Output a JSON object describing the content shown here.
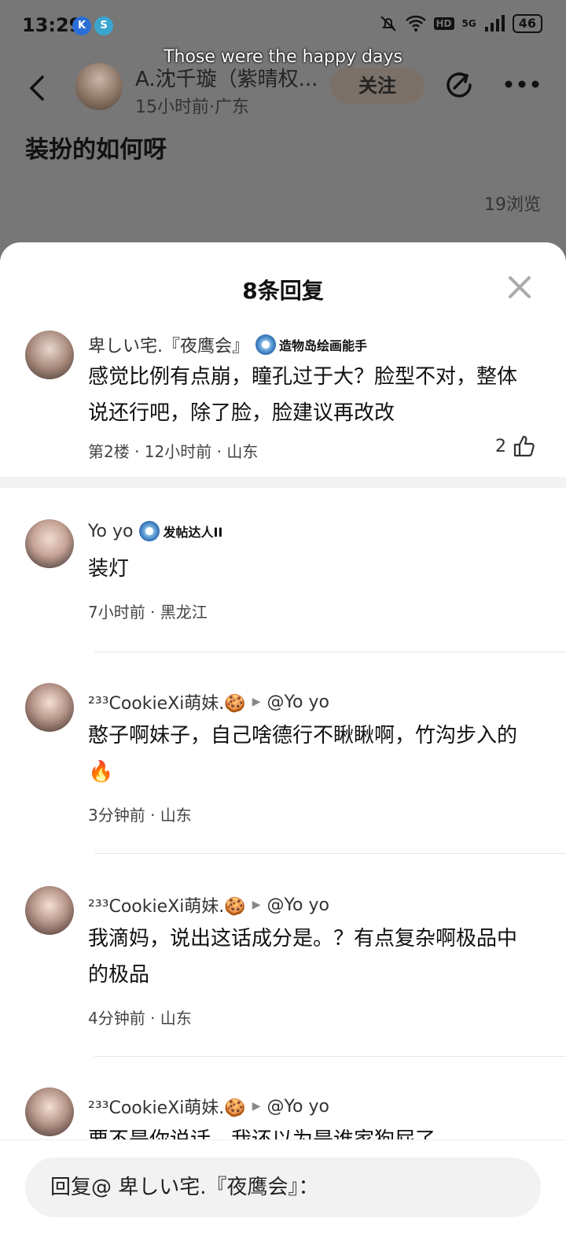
{
  "status_bar": {
    "time": "13:29",
    "app_icons": [
      "K",
      "S"
    ],
    "network": "5G",
    "hd": "HD",
    "battery": "46"
  },
  "watermark": "Those were the happy days",
  "post": {
    "author_name": "A.沈千璇（紫晴权...",
    "author_meta": "15小时前·广东",
    "follow_label": "关注",
    "title": "装扮的如何呀",
    "views": "19浏览"
  },
  "sheet": {
    "title": "8条回复",
    "main_comment": {
      "name": "卑しい宅.『夜鹰会』",
      "badge": "造物岛绘画能手",
      "text": "感觉比例有点崩，瞳孔过于大？脸型不对，整体说还行吧，除了脸，脸建议再改改",
      "meta": "第2楼 · 12小时前 · 山东",
      "likes": "2"
    },
    "replies": [
      {
        "name": "Yo yo",
        "badge": "发帖达人II",
        "text": "装灯",
        "meta": "7小时前 · 黑龙江"
      },
      {
        "name": "²³³CookieXi萌妹.🍪",
        "reply_to": "@Yo yo",
        "text": "憨子啊妹子，自己啥德行不瞅瞅啊，竹沟步入的🔥",
        "meta": "3分钟前 · 山东"
      },
      {
        "name": "²³³CookieXi萌妹.🍪",
        "reply_to": "@Yo yo",
        "text": "我滴妈，说出这话成分是。？有点复杂啊极品中的极品",
        "meta": "4分钟前 · 山东"
      },
      {
        "name": "²³³CookieXi萌妹.🍪",
        "reply_to": "@Yo yo",
        "text": "要不是你说话，我还以为是谁家狗屁了",
        "meta": ""
      }
    ],
    "reply_placeholder": "回复@ 卑しい宅.『夜鹰会』："
  }
}
